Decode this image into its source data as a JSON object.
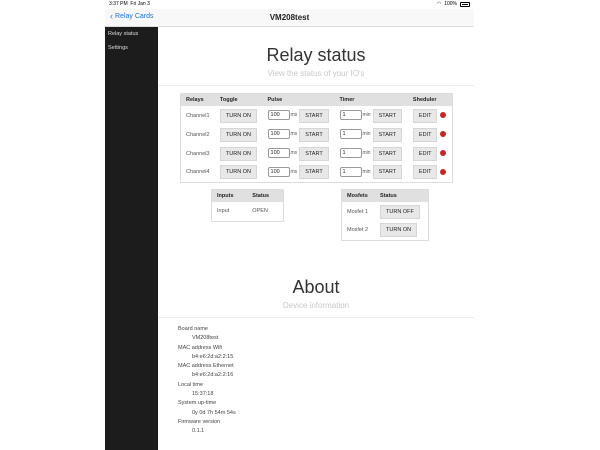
{
  "statusbar": {
    "time": "3:37 PM",
    "date": "Fri Jan 3",
    "battery": "100%"
  },
  "navbar": {
    "back_label": "Relay Cards",
    "title": "VM208test"
  },
  "sidebar": {
    "items": [
      {
        "label": "Relay status"
      },
      {
        "label": "Settings"
      }
    ]
  },
  "relay": {
    "title": "Relay status",
    "subtitle": "View the status of your IO's",
    "headers": [
      "Relays",
      "Toggle",
      "Pulse",
      "Timer",
      "Sheduler"
    ],
    "pulse_unit": "ms",
    "timer_unit": "min",
    "start_label": "START",
    "edit_label": "EDIT",
    "rows": [
      {
        "name": "Channel1",
        "toggle": "TURN ON",
        "pulse": "100",
        "timer": "1"
      },
      {
        "name": "Channel2",
        "toggle": "TURN ON",
        "pulse": "100",
        "timer": "1"
      },
      {
        "name": "Channel3",
        "toggle": "TURN ON",
        "pulse": "100",
        "timer": "1"
      },
      {
        "name": "Channel4",
        "toggle": "TURN ON",
        "pulse": "100",
        "timer": "1"
      }
    ],
    "status_dot_color": "#c62828"
  },
  "inputs": {
    "headers": [
      "Inputs",
      "Status"
    ],
    "rows": [
      {
        "name": "Input",
        "status": "OPEN"
      }
    ]
  },
  "mosfets": {
    "headers": [
      "Mosfets",
      "Status"
    ],
    "rows": [
      {
        "name": "Mosfet 1",
        "action": "TURN OFF"
      },
      {
        "name": "Mosfet 2",
        "action": "TURN ON"
      }
    ]
  },
  "about": {
    "title": "About",
    "subtitle": "Device information",
    "fields": [
      {
        "label": "Board name",
        "value": "VM208test"
      },
      {
        "label": "MAC address Wifi",
        "value": "b4:e6:2d:a2:2:15"
      },
      {
        "label": "MAC address Ethernet",
        "value": "b4:e6:2d:a2:2:16"
      },
      {
        "label": "Local time",
        "value": "15:37:18"
      },
      {
        "label": "System up-time",
        "value": "0y 0d 7h 54m 54s"
      },
      {
        "label": "Firmware version",
        "value": "0.1.1"
      }
    ]
  }
}
